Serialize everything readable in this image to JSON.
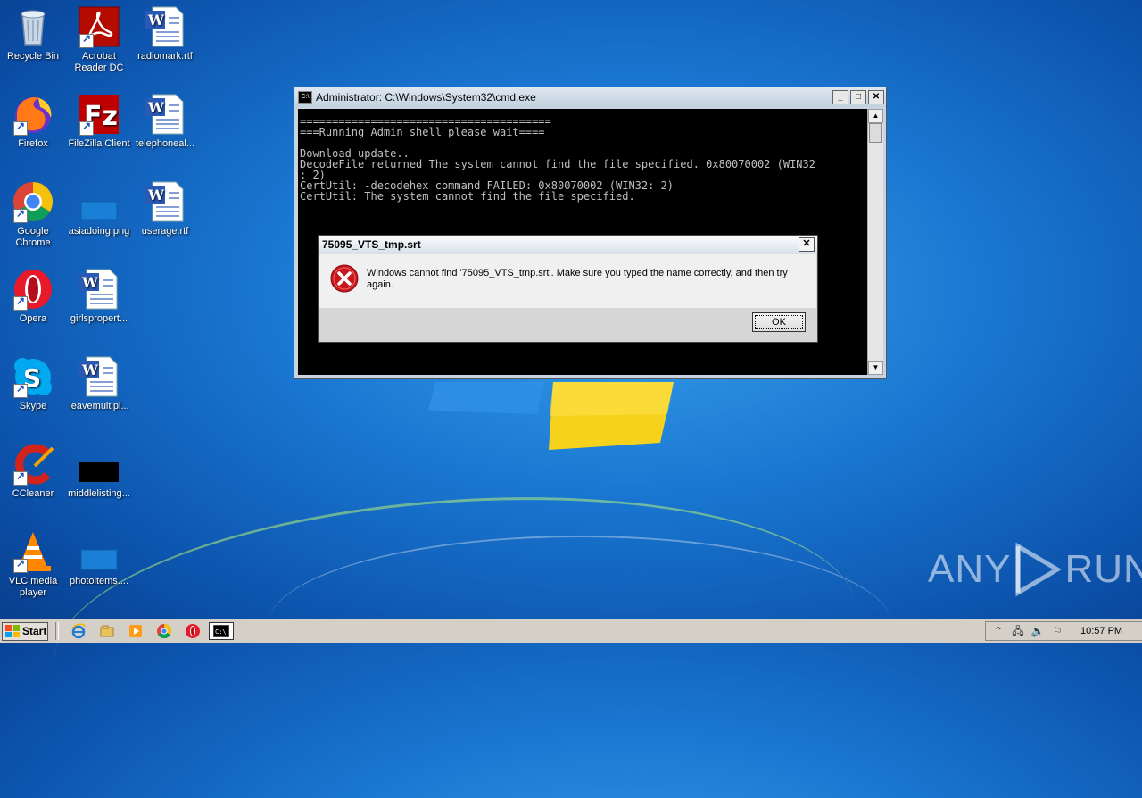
{
  "desktop": {
    "icons": [
      {
        "label": "Recycle Bin",
        "icon": "recycle-bin-icon"
      },
      {
        "label": "Acrobat Reader DC",
        "icon": "acrobat-icon"
      },
      {
        "label": "radiomark.rtf",
        "icon": "word-doc-icon"
      },
      {
        "label": "Firefox",
        "icon": "firefox-icon"
      },
      {
        "label": "FileZilla Client",
        "icon": "filezilla-icon"
      },
      {
        "label": "telephoneal...",
        "icon": "word-doc-icon"
      },
      {
        "label": "Google Chrome",
        "icon": "chrome-icon"
      },
      {
        "label": "asiadoing.png",
        "icon": "image-file-icon"
      },
      {
        "label": "userage.rtf",
        "icon": "word-doc-icon"
      },
      {
        "label": "Opera",
        "icon": "opera-icon"
      },
      {
        "label": "girlspropert...",
        "icon": "word-doc-icon"
      },
      {
        "label": "Skype",
        "icon": "skype-icon"
      },
      {
        "label": "leavemultipl...",
        "icon": "word-doc-icon"
      },
      {
        "label": "CCleaner",
        "icon": "ccleaner-icon"
      },
      {
        "label": "middlelisting...",
        "icon": "image-file-icon"
      },
      {
        "label": "VLC media player",
        "icon": "vlc-icon"
      },
      {
        "label": "photoitems....",
        "icon": "image-file-icon"
      }
    ]
  },
  "cmd_window": {
    "title": "Administrator: C:\\Windows\\System32\\cmd.exe",
    "minimize": "_",
    "maximize": "□",
    "close": "✕",
    "output": "=======================================\n===Running Admin shell please wait====\n\nDownload update..\nDecodeFile returned The system cannot find the file specified. 0x80070002 (WIN32\n: 2)\nCertUtil: -decodehex command FAILED: 0x80070002 (WIN32: 2)\nCertUtil: The system cannot find the file specified."
  },
  "dialog": {
    "title": "75095_VTS_tmp.srt",
    "close": "✕",
    "message": "Windows cannot find '75095_VTS_tmp.srt'. Make sure you typed the name correctly, and then try again.",
    "ok_label": "OK",
    "icon": "error-icon"
  },
  "taskbar": {
    "start_label": "Start",
    "clock": "10:57 PM",
    "quick_launch": [
      "ie-icon",
      "explorer-icon",
      "media-player-icon",
      "chrome-icon",
      "opera-icon",
      "cmd-icon"
    ]
  },
  "watermark": {
    "left": "ANY",
    "right": "RUN"
  }
}
